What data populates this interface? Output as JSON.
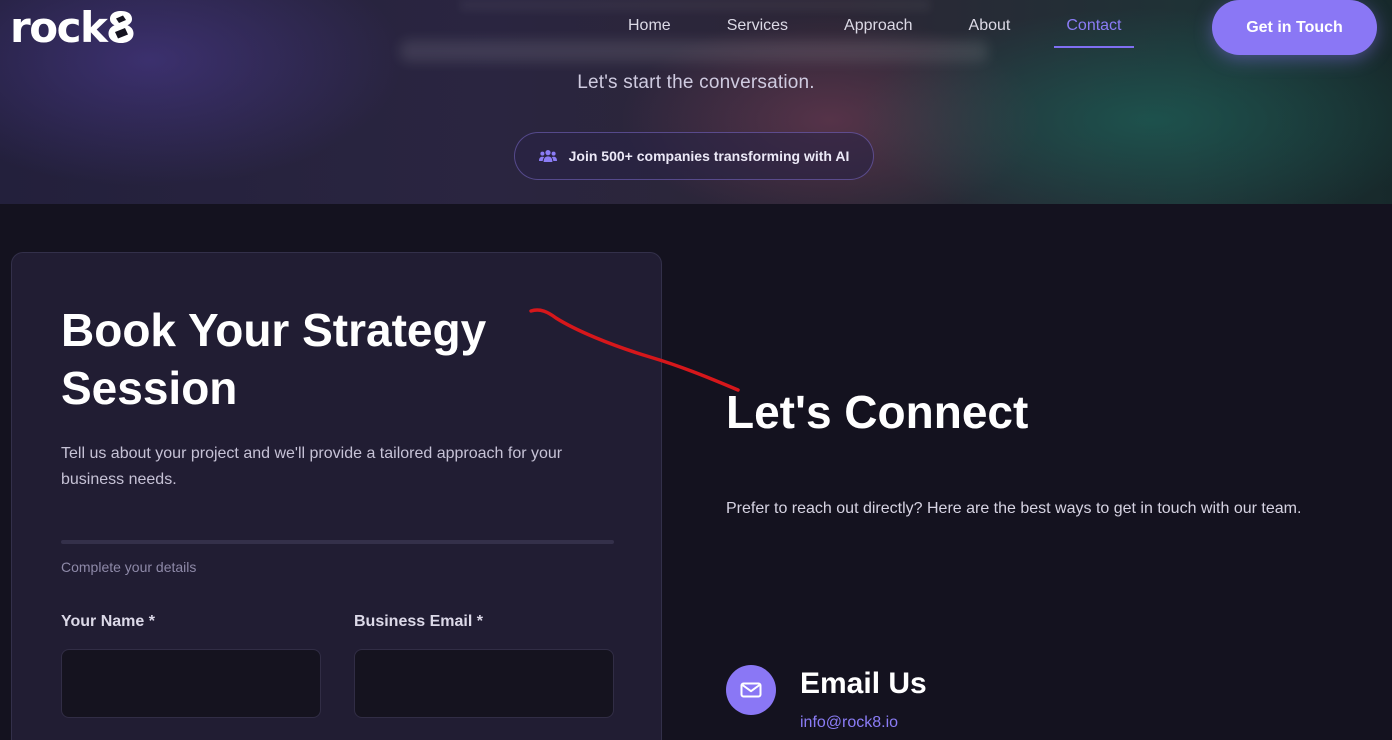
{
  "brand": {
    "logo_text": "rock",
    "logo_mark": "8"
  },
  "nav": {
    "items": [
      {
        "label": "Home"
      },
      {
        "label": "Services"
      },
      {
        "label": "Approach"
      },
      {
        "label": "About"
      },
      {
        "label": "Contact",
        "active": true
      }
    ],
    "cta_label": "Get in Touch"
  },
  "hero": {
    "subtitle": "Let's start the conversation.",
    "pill_icon": "users-icon",
    "pill_text": "Join 500+ companies transforming with AI"
  },
  "form": {
    "title": "Book Your Strategy Session",
    "description": "Tell us about your project and we'll provide a tailored approach for your business needs.",
    "step_label": "Complete your details",
    "fields": [
      {
        "label": "Your Name *",
        "value": "",
        "placeholder": ""
      },
      {
        "label": "Business Email *",
        "value": "",
        "placeholder": ""
      }
    ]
  },
  "connect": {
    "title": "Let's Connect",
    "description": "Prefer to reach out directly? Here are the best ways to get in touch with our team.",
    "email": {
      "icon": "envelope-icon",
      "title": "Email Us",
      "address": "info@rock8.io"
    }
  },
  "colors": {
    "accent": "#8a77f5",
    "background": "#14121f",
    "card": "#211d33",
    "annotation": "#d6171b"
  }
}
